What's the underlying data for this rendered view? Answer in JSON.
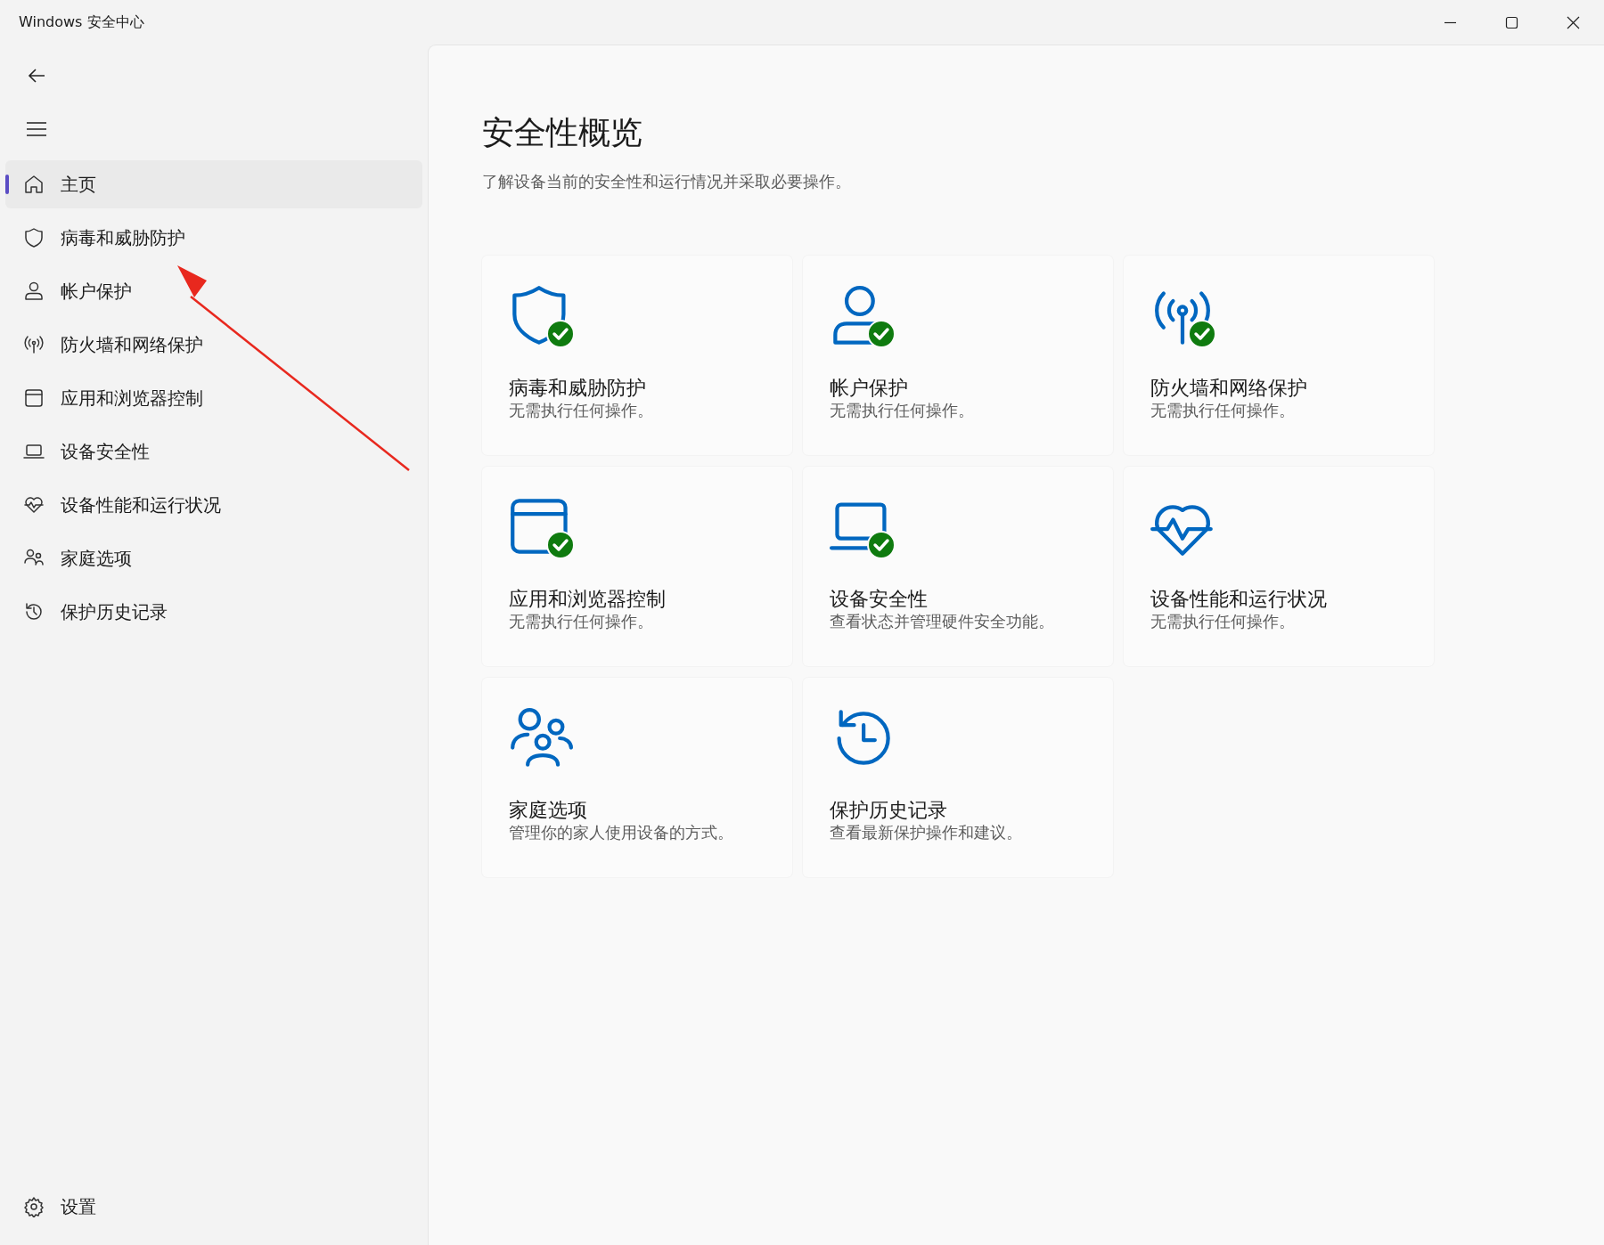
{
  "window": {
    "title": "Windows 安全中心"
  },
  "sidebar": {
    "items": [
      {
        "label": "主页",
        "selected": true
      },
      {
        "label": "病毒和威胁防护",
        "selected": false
      },
      {
        "label": "帐户保护",
        "selected": false
      },
      {
        "label": "防火墙和网络保护",
        "selected": false
      },
      {
        "label": "应用和浏览器控制",
        "selected": false
      },
      {
        "label": "设备安全性",
        "selected": false
      },
      {
        "label": "设备性能和运行状况",
        "selected": false
      },
      {
        "label": "家庭选项",
        "selected": false
      },
      {
        "label": "保护历史记录",
        "selected": false
      }
    ],
    "settings": {
      "label": "设置"
    }
  },
  "main": {
    "heading": "安全性概览",
    "subtitle": "了解设备当前的安全性和运行情况并采取必要操作。",
    "cards": [
      {
        "title": "病毒和威胁防护",
        "description": "无需执行任何操作。",
        "status_ok": true
      },
      {
        "title": "帐户保护",
        "description": "无需执行任何操作。",
        "status_ok": true
      },
      {
        "title": "防火墙和网络保护",
        "description": "无需执行任何操作。",
        "status_ok": true
      },
      {
        "title": "应用和浏览器控制",
        "description": "无需执行任何操作。",
        "status_ok": true
      },
      {
        "title": "设备安全性",
        "description": "查看状态并管理硬件安全功能。",
        "status_ok": true
      },
      {
        "title": "设备性能和运行状况",
        "description": "无需执行任何操作。",
        "status_ok": false
      },
      {
        "title": "家庭选项",
        "description": "管理你的家人使用设备的方式。",
        "status_ok": false
      },
      {
        "title": "保护历史记录",
        "description": "查看最新保护操作和建议。",
        "status_ok": false
      }
    ]
  }
}
